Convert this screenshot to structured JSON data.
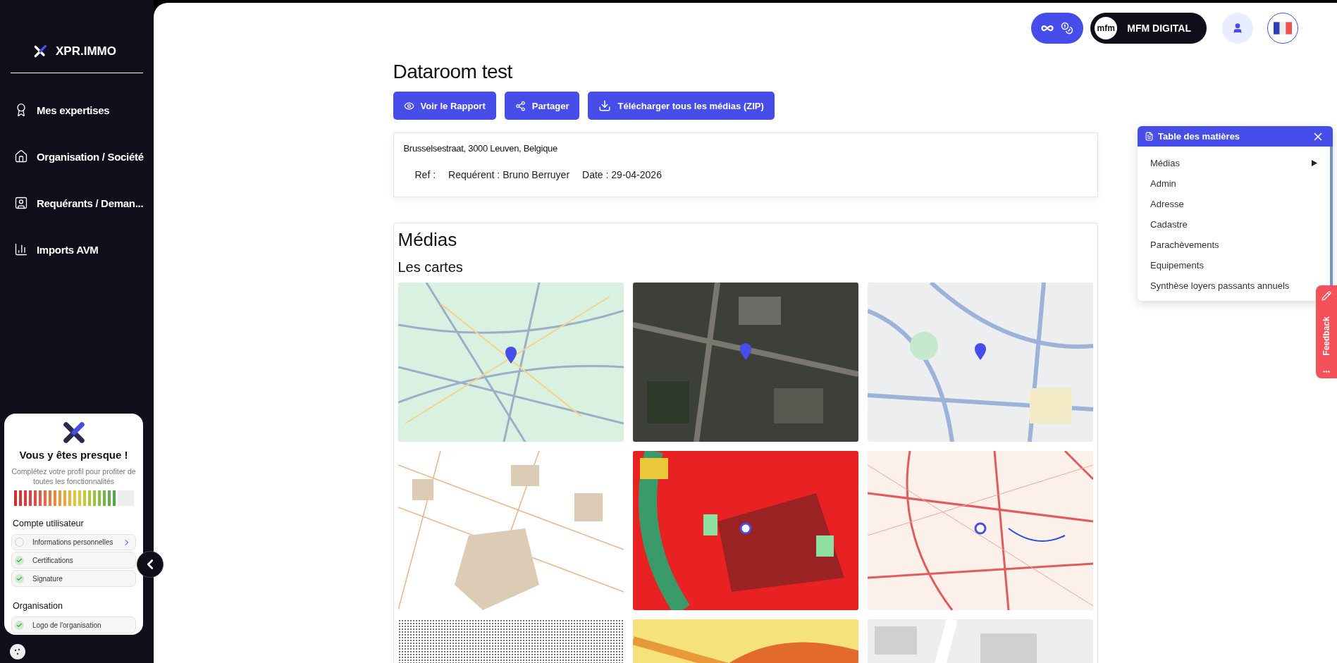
{
  "sidebar": {
    "brand": "XPR.IMMO",
    "items": [
      {
        "label": "Mes expertises",
        "kind": "award"
      },
      {
        "label": "Organisation / Société",
        "kind": "home"
      },
      {
        "label": "Requérants / Deman...",
        "kind": "contact"
      },
      {
        "label": "Imports AVM",
        "kind": "chart"
      }
    ]
  },
  "profile_card": {
    "title": "Vous y êtes presque !",
    "subtitle": "Complétez votre profil pour profiter de toutes les fonctionnalités",
    "progress": {
      "level": 0.87
    },
    "sections": [
      {
        "title": "Compte utilisateur",
        "items": [
          {
            "label": "Informations personnelles",
            "checked": false
          },
          {
            "label": "Certifications",
            "checked": true
          },
          {
            "label": "Signature",
            "checked": true
          }
        ]
      },
      {
        "title": "Organisation",
        "items": [
          {
            "label": "Logo de l'organisation",
            "checked": true
          }
        ]
      }
    ]
  },
  "header": {
    "logo_text": "mfm",
    "account": "MFM DIGITAL"
  },
  "page": {
    "title": "Dataroom test",
    "buttons": [
      {
        "label": "Voir le Rapport",
        "kind": "view"
      },
      {
        "label": "Partager",
        "kind": "share"
      },
      {
        "label": "Télécharger tous les médias (ZIP)",
        "kind": "download"
      }
    ],
    "info": {
      "address": "Brusselsestraat, 3000 Leuven, Belgique",
      "fields": [
        "Ref :",
        "Requérent : Bruno Berruyer",
        "Date : 29-04-2026"
      ]
    }
  },
  "media": {
    "title": "Médias",
    "subtitle": "Les cartes",
    "maps": [
      {
        "kind": "street"
      },
      {
        "kind": "aerial"
      },
      {
        "kind": "city"
      },
      {
        "kind": "cadastre"
      },
      {
        "kind": "zoning"
      },
      {
        "kind": "network"
      },
      {
        "kind": "dots"
      },
      {
        "kind": "heat"
      },
      {
        "kind": "grey"
      }
    ]
  },
  "toc": {
    "title": "Table des matières",
    "items": [
      {
        "label": "Médias",
        "has_children": true
      },
      {
        "label": "Admin",
        "has_children": false
      },
      {
        "label": "Adresse",
        "has_children": false
      },
      {
        "label": "Cadastre",
        "has_children": false
      },
      {
        "label": "Parachèvements",
        "has_children": false
      },
      {
        "label": "Equipements",
        "has_children": false
      },
      {
        "label": "Synthèse loyers passants annuels",
        "has_children": false
      }
    ]
  },
  "feedback": {
    "label": "Feedback"
  }
}
